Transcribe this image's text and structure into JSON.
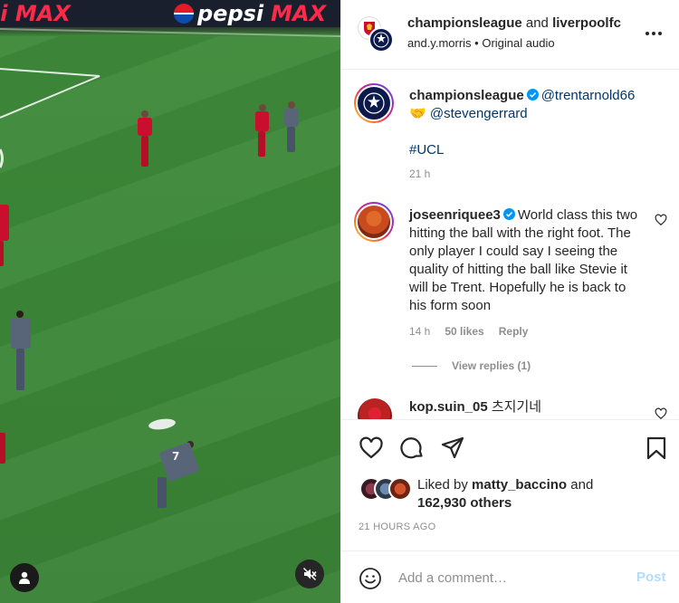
{
  "video": {
    "ad_left_text": "si MAX",
    "ad_pepsi_word": "pepsi",
    "ad_pepsi_max": "MAX",
    "player_numbers": [
      "7"
    ]
  },
  "header": {
    "account_1": "championsleague",
    "joiner": " and ",
    "account_2": "liverpoolfc",
    "subtitle_user": "and.y.morris",
    "subtitle_sep": " • ",
    "subtitle_audio": "Original audio"
  },
  "caption": {
    "username": "championsleague",
    "mention_1": "@trentarnold66",
    "emoji": "🤝",
    "mention_2": "@stevengerrard",
    "hashtag": "#UCL",
    "time": "21 h"
  },
  "comments": [
    {
      "username": "joseenriquee3",
      "text": "World class this two hitting the ball with the right foot. The only player I could say I seeing the quality of hitting the ball like Stevie it will be Trent. Hopefully he is back to his form soon",
      "time": "14 h",
      "likes": "50 likes",
      "reply": "Reply",
      "view_replies": "View replies (1)"
    },
    {
      "username": "kop.suin_05",
      "text": "츠지기네"
    }
  ],
  "likes": {
    "prefix": "Liked by ",
    "user": "matty_baccino",
    "joiner": " and",
    "count": "162,930 others"
  },
  "timestamp": "21 HOURS AGO",
  "add_comment": {
    "placeholder": "Add a comment…",
    "post_label": "Post"
  },
  "colors": {
    "link": "#00376b",
    "muted": "#8e8e8e",
    "post_disabled": "#b3dbff",
    "verified": "#0095f6",
    "pitch": "#3c8838"
  }
}
